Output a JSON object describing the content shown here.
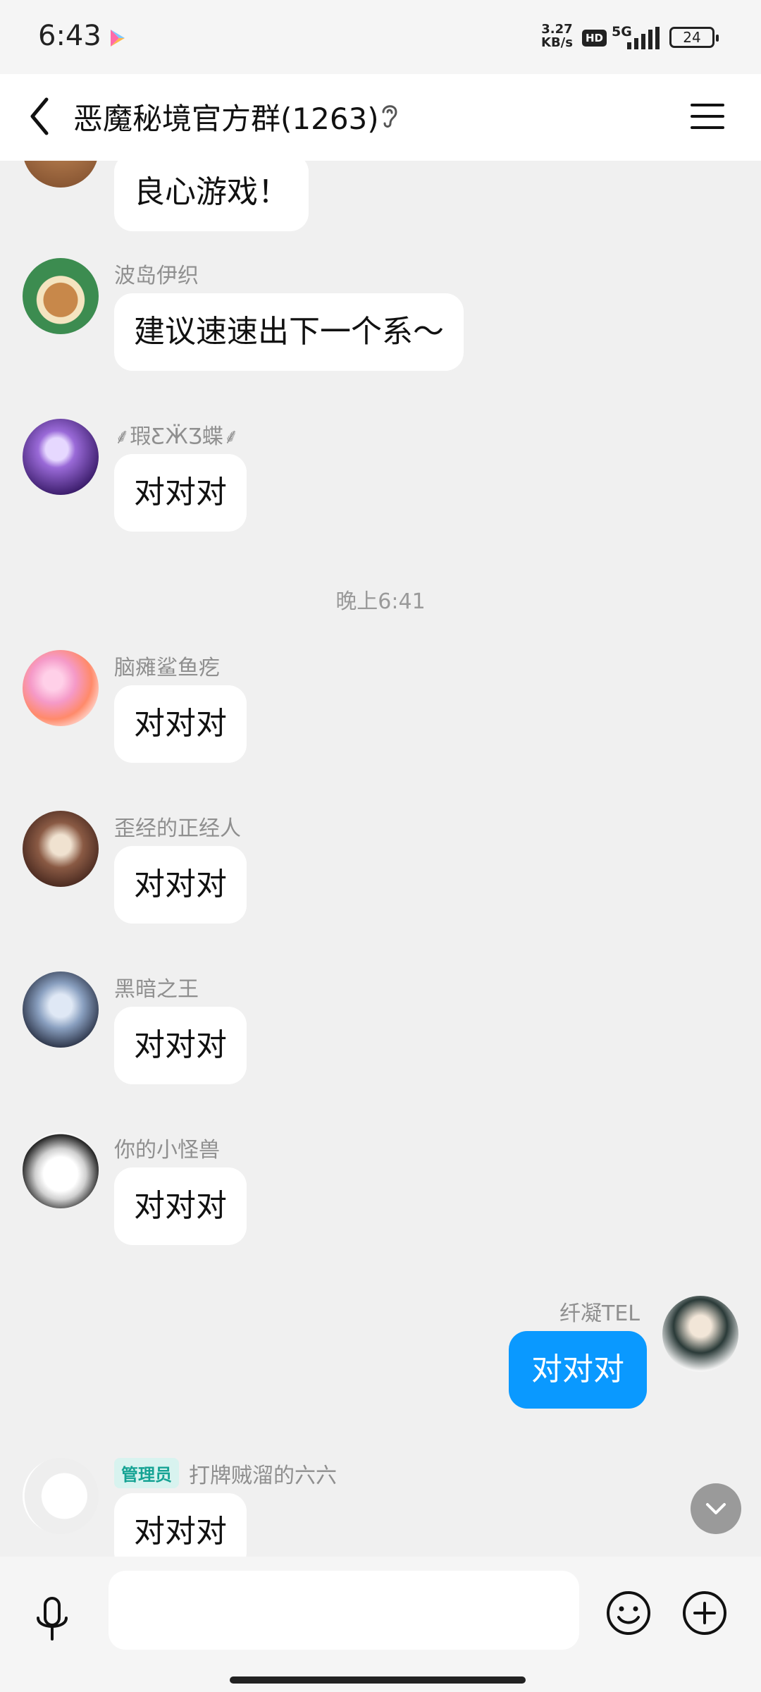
{
  "status_bar": {
    "time": "6:43",
    "network_speed": "3.27",
    "network_speed_unit": "KB/s",
    "hd": "HD",
    "net_type": "5G",
    "battery": "24"
  },
  "header": {
    "title": "恶魔秘境官方群(1263)"
  },
  "messages": [
    {
      "sender": "",
      "text": "良心游戏！"
    },
    {
      "sender": "波岛伊织",
      "text": "建议速速出下一个系～"
    },
    {
      "sender": "⸙瑕ƸӜƷ蝶⸙",
      "text": "对对对"
    },
    {
      "sender": "脑瘫鲨鱼疙",
      "text": "对对对"
    },
    {
      "sender": "歪经的正经人",
      "text": "对对对"
    },
    {
      "sender": "黑暗之王",
      "text": "对对对"
    },
    {
      "sender": "你的小怪兽",
      "text": "对对对"
    },
    {
      "sender": "打牌贼溜的六六",
      "badge": "管理员",
      "text": "对对对"
    }
  ],
  "time_separator": "晚上6:41",
  "self_message": {
    "sender": "纤凝TEL",
    "text": "对对对"
  },
  "input": {
    "placeholder": ""
  },
  "colors": {
    "accent": "#0a99ff",
    "background": "#f0f0f0",
    "bubble": "#ffffff",
    "admin_badge": "#16a394"
  },
  "icons": [
    "back-icon",
    "ear-icon",
    "menu-icon",
    "mic-icon",
    "emoji-icon",
    "plus-icon",
    "chevron-down-icon"
  ]
}
